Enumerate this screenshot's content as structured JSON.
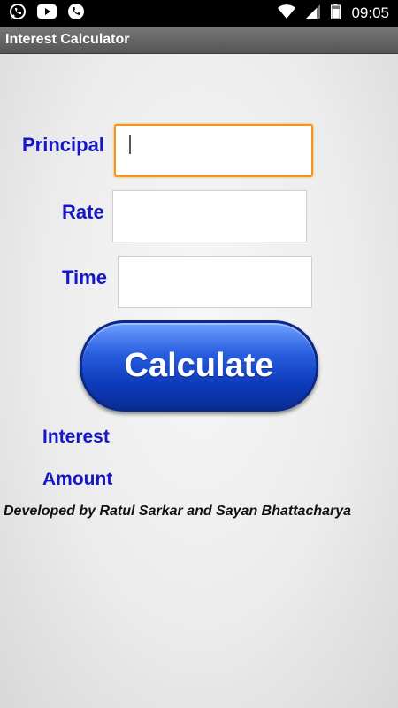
{
  "status_bar": {
    "time": "09:05",
    "left_icons": [
      "whatsapp-icon",
      "youtube-icon",
      "phone-icon"
    ],
    "right_icons": [
      "wifi-icon",
      "signal-icon",
      "battery-icon"
    ]
  },
  "app_bar": {
    "title": "Interest Calculator"
  },
  "form": {
    "principal_label": "Principal",
    "principal_value": "",
    "rate_label": "Rate",
    "rate_value": "",
    "time_label": "Time",
    "time_value": ""
  },
  "calculate_label": "Calculate",
  "results": {
    "interest_label": "Interest",
    "amount_label": "Amount"
  },
  "footer": {
    "credit": "Developed by Ratul Sarkar and Sayan Bhattacharya"
  },
  "colors": {
    "label_blue": "#1616c8",
    "focus_orange": "#f0961e",
    "button_blue": "#0d3bbb"
  }
}
